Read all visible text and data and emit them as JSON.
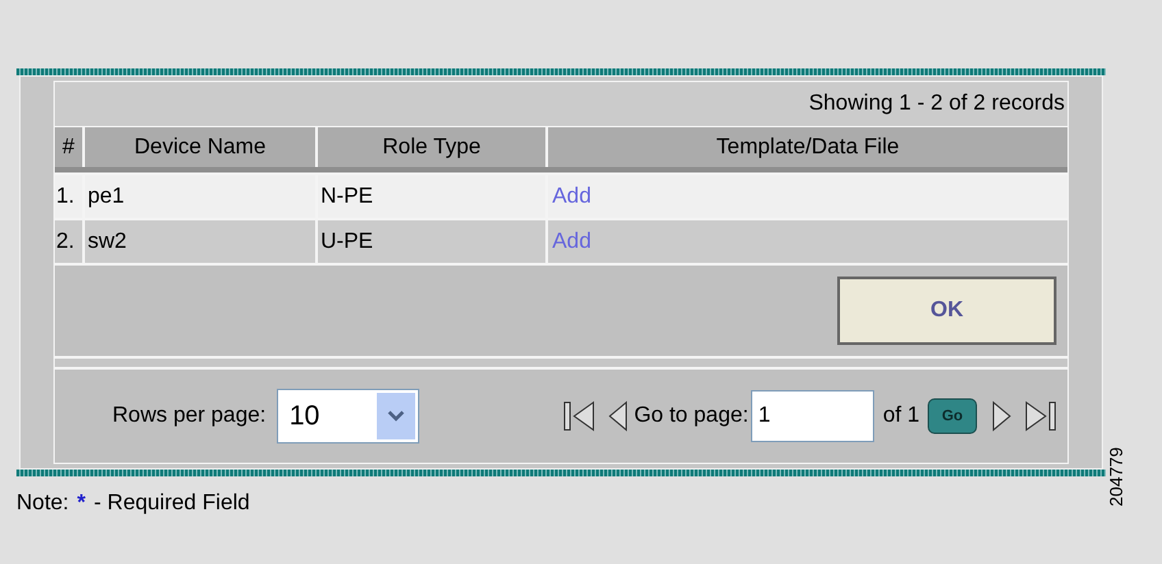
{
  "table": {
    "summary": "Showing 1 - 2 of 2 records",
    "columns": [
      "#",
      "Device Name",
      "Role Type",
      "Template/Data File"
    ],
    "rows": [
      {
        "index": "1.",
        "device": "pe1",
        "role": "N-PE",
        "link": "Add"
      },
      {
        "index": "2.",
        "device": "sw2",
        "role": "U-PE",
        "link": "Add"
      }
    ]
  },
  "ok_button": "OK",
  "pagination": {
    "rows_label": "Rows per page:",
    "rows_value": "10",
    "goto_label": "Go to page:",
    "page_value": "1",
    "of_label": "of 1",
    "go_button": "Go"
  },
  "note": {
    "prefix": "Note:",
    "star": "*",
    "text": "- Required Field"
  },
  "figure_number": "204779"
}
